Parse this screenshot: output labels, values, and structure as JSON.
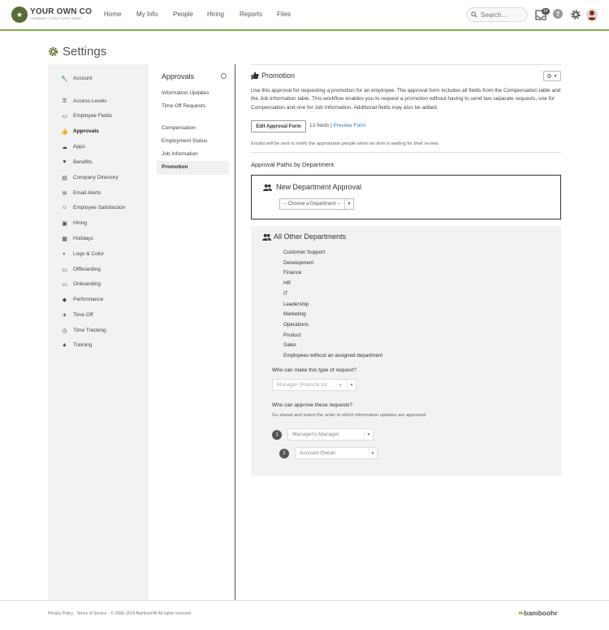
{
  "header": {
    "logo_text": "YOUR OWN CO",
    "logo_subtext": "COMPANY LOGO GOES HERE",
    "nav": [
      "Home",
      "My Info",
      "People",
      "Hiring",
      "Reports",
      "Files"
    ],
    "search_placeholder": "Search...",
    "inbox_badge": "14",
    "help_label": "?",
    "accent_color": "#82b440"
  },
  "page": {
    "title": "Settings"
  },
  "settings_nav": {
    "items": [
      {
        "label": "Account",
        "icon": "wrench-icon"
      },
      {
        "label": "Access Levels",
        "icon": "key-icon"
      },
      {
        "label": "Employee Fields",
        "icon": "id-card-icon"
      },
      {
        "label": "Approvals",
        "icon": "thumbs-up-icon",
        "active": true
      },
      {
        "label": "Apps",
        "icon": "cloud-icon"
      },
      {
        "label": "Benefits",
        "icon": "heart-icon"
      },
      {
        "label": "Company Directory",
        "icon": "directory-icon"
      },
      {
        "label": "Email Alerts",
        "icon": "envelope-icon"
      },
      {
        "label": "Employee Satisfaction",
        "icon": "smile-icon"
      },
      {
        "label": "Hiring",
        "icon": "clipboard-icon"
      },
      {
        "label": "Holidays",
        "icon": "gift-icon"
      },
      {
        "label": "Logo & Color",
        "icon": "palette-icon"
      },
      {
        "label": "Offboarding",
        "icon": "offboarding-icon"
      },
      {
        "label": "Onboarding",
        "icon": "onboarding-icon"
      },
      {
        "label": "Performance",
        "icon": "performance-icon"
      },
      {
        "label": "Time Off",
        "icon": "plane-icon"
      },
      {
        "label": "Time Tracking",
        "icon": "clock-icon"
      },
      {
        "label": "Training",
        "icon": "grad-cap-icon"
      }
    ]
  },
  "approvals_nav": {
    "heading": "Approvals",
    "group1": [
      "Information Updates",
      "Time Off Requests"
    ],
    "group2": [
      "Compensation",
      "Employment Status",
      "Job Information",
      "Promotion"
    ]
  },
  "main": {
    "title": "Promotion",
    "description": "Use this approval for requesting a promotion for an employee. The approval form includes all fields from the Compensation table and the Job Information table. This workflow enables you to request a promotion without having to send two separate requests, one for Compensation and one for Job Information. Additional fields may also be added.",
    "edit_button": "Edit Approval Form",
    "fields_count": "13 fields",
    "separator": "|",
    "preview_link": "Preview Form",
    "emails_note": "Emails will be sent to notify the appropriate people when an item is waiting for their review.",
    "paths_heading": "Approval Paths by Department",
    "new_dept_title": "New Department Approval",
    "new_dept_select": "-- Choose a Department --",
    "other_title": "All Other Departments",
    "departments": [
      "Customer Support",
      "Development",
      "Finance",
      "HR",
      "IT",
      "Leadership",
      "Marketing",
      "Operations",
      "Product",
      "Sales",
      "Employees without an assigned department"
    ],
    "who_request_label": "Who can make this type of request?",
    "who_request_value": "Manager (Reports to)",
    "who_approve_label": "Who can approve these requests?",
    "who_approve_sub": "Go ahead and select the order in which information updates are approved.",
    "approvers": [
      {
        "num": "1",
        "value": "Manager's Manager"
      },
      {
        "num": "2",
        "value": "Account Owner"
      }
    ]
  },
  "footer": {
    "links": "Privacy Policy  ·  Terms of Service  ·  © 2008–2019 BambooHR All rights reserved.",
    "brand": "bamboohr"
  }
}
